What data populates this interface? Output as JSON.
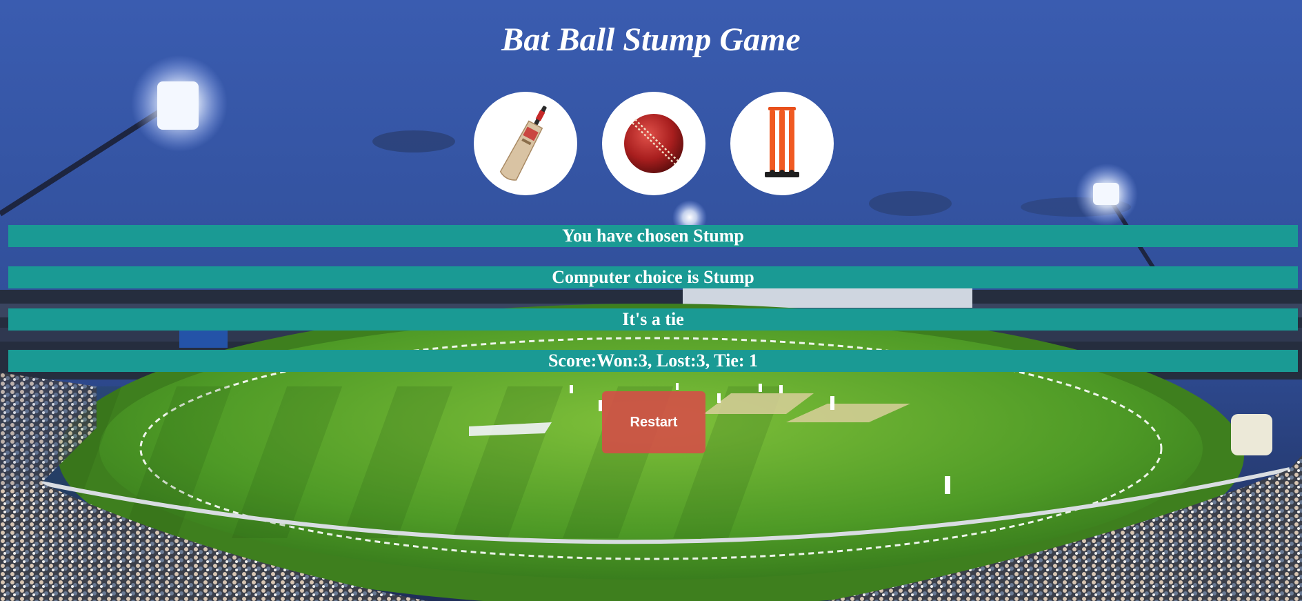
{
  "game": {
    "title": "Bat Ball Stump Game"
  },
  "choices": [
    {
      "id": "bat",
      "icon": "cricket-bat-icon"
    },
    {
      "id": "ball",
      "icon": "cricket-ball-icon"
    },
    {
      "id": "stump",
      "icon": "stumps-icon"
    }
  ],
  "results": {
    "user_choice": "You have chosen Stump",
    "computer_choice": "Computer choice is Stump",
    "outcome": "It's a tie",
    "score": "Score:Won:3, Lost:3, Tie: 1"
  },
  "restart": {
    "label": "Restart"
  },
  "colors": {
    "bar_bg": "#1a9a94",
    "restart_bg": "#d64c48",
    "sky": "#3c5aa8",
    "field": "#4a8f22"
  }
}
